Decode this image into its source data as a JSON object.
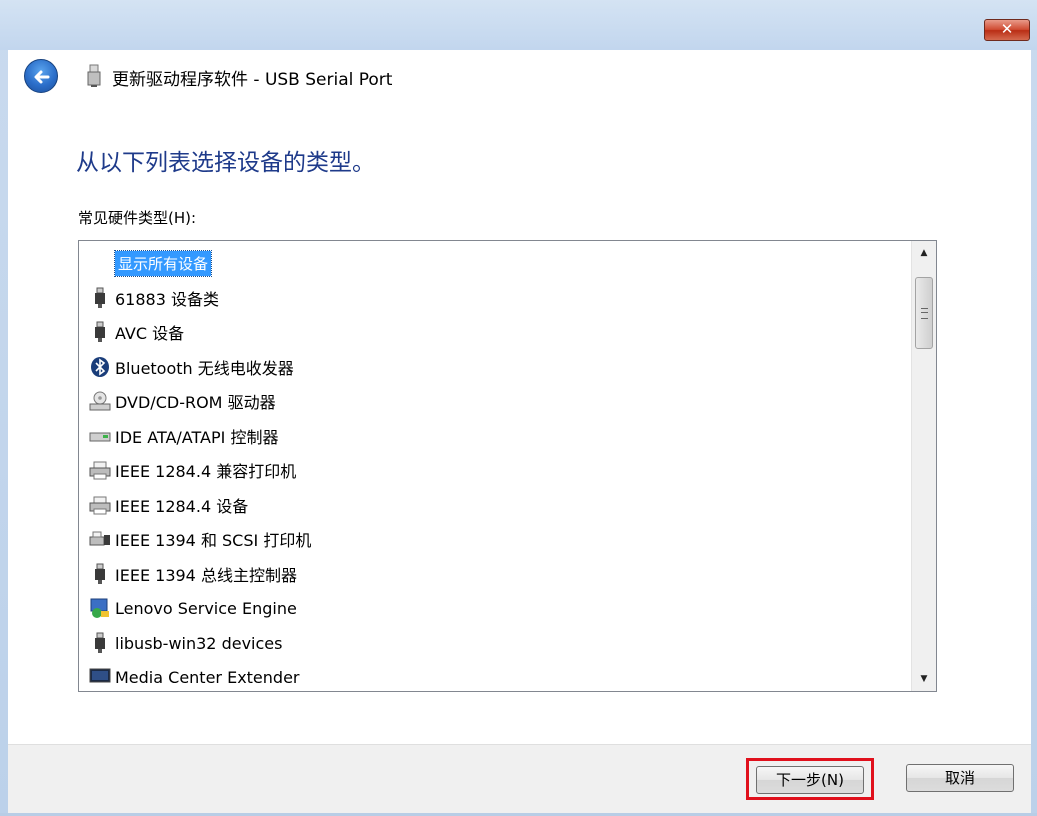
{
  "window": {
    "close_glyph": "✕"
  },
  "header": {
    "title": "更新驱动程序软件 - USB Serial Port",
    "back_icon": "back-arrow-icon",
    "device_icon": "usb-connector-icon"
  },
  "main": {
    "instruction": "从以下列表选择设备的类型。",
    "list_label": "常见硬件类型(H):",
    "items": [
      {
        "label": "显示所有设备",
        "icon": "none",
        "selected": true
      },
      {
        "label": "61883 设备类",
        "icon": "usb-plug-icon"
      },
      {
        "label": "AVC 设备",
        "icon": "usb-plug-icon"
      },
      {
        "label": "Bluetooth 无线电收发器",
        "icon": "bluetooth-icon"
      },
      {
        "label": "DVD/CD-ROM 驱动器",
        "icon": "optical-drive-icon"
      },
      {
        "label": "IDE ATA/ATAPI 控制器",
        "icon": "ide-controller-icon"
      },
      {
        "label": "IEEE 1284.4 兼容打印机",
        "icon": "printer-icon"
      },
      {
        "label": "IEEE 1284.4 设备",
        "icon": "printer-icon"
      },
      {
        "label": "IEEE 1394 和 SCSI 打印机",
        "icon": "printer-plug-icon"
      },
      {
        "label": "IEEE 1394 总线主控制器",
        "icon": "usb-plug-icon"
      },
      {
        "label": "Lenovo Service Engine",
        "icon": "network-globe-icon"
      },
      {
        "label": "libusb-win32 devices",
        "icon": "usb-plug-icon"
      },
      {
        "label": "Media Center Extender",
        "icon": "monitor-icon"
      }
    ],
    "scroll_up_glyph": "▲",
    "scroll_down_glyph": "▼"
  },
  "footer": {
    "next_label": "下一步(N)",
    "cancel_label": "取消"
  },
  "colors": {
    "selection": "#3399ff",
    "instruction_text": "#1e3a8a",
    "highlight_box": "#e0101c"
  }
}
